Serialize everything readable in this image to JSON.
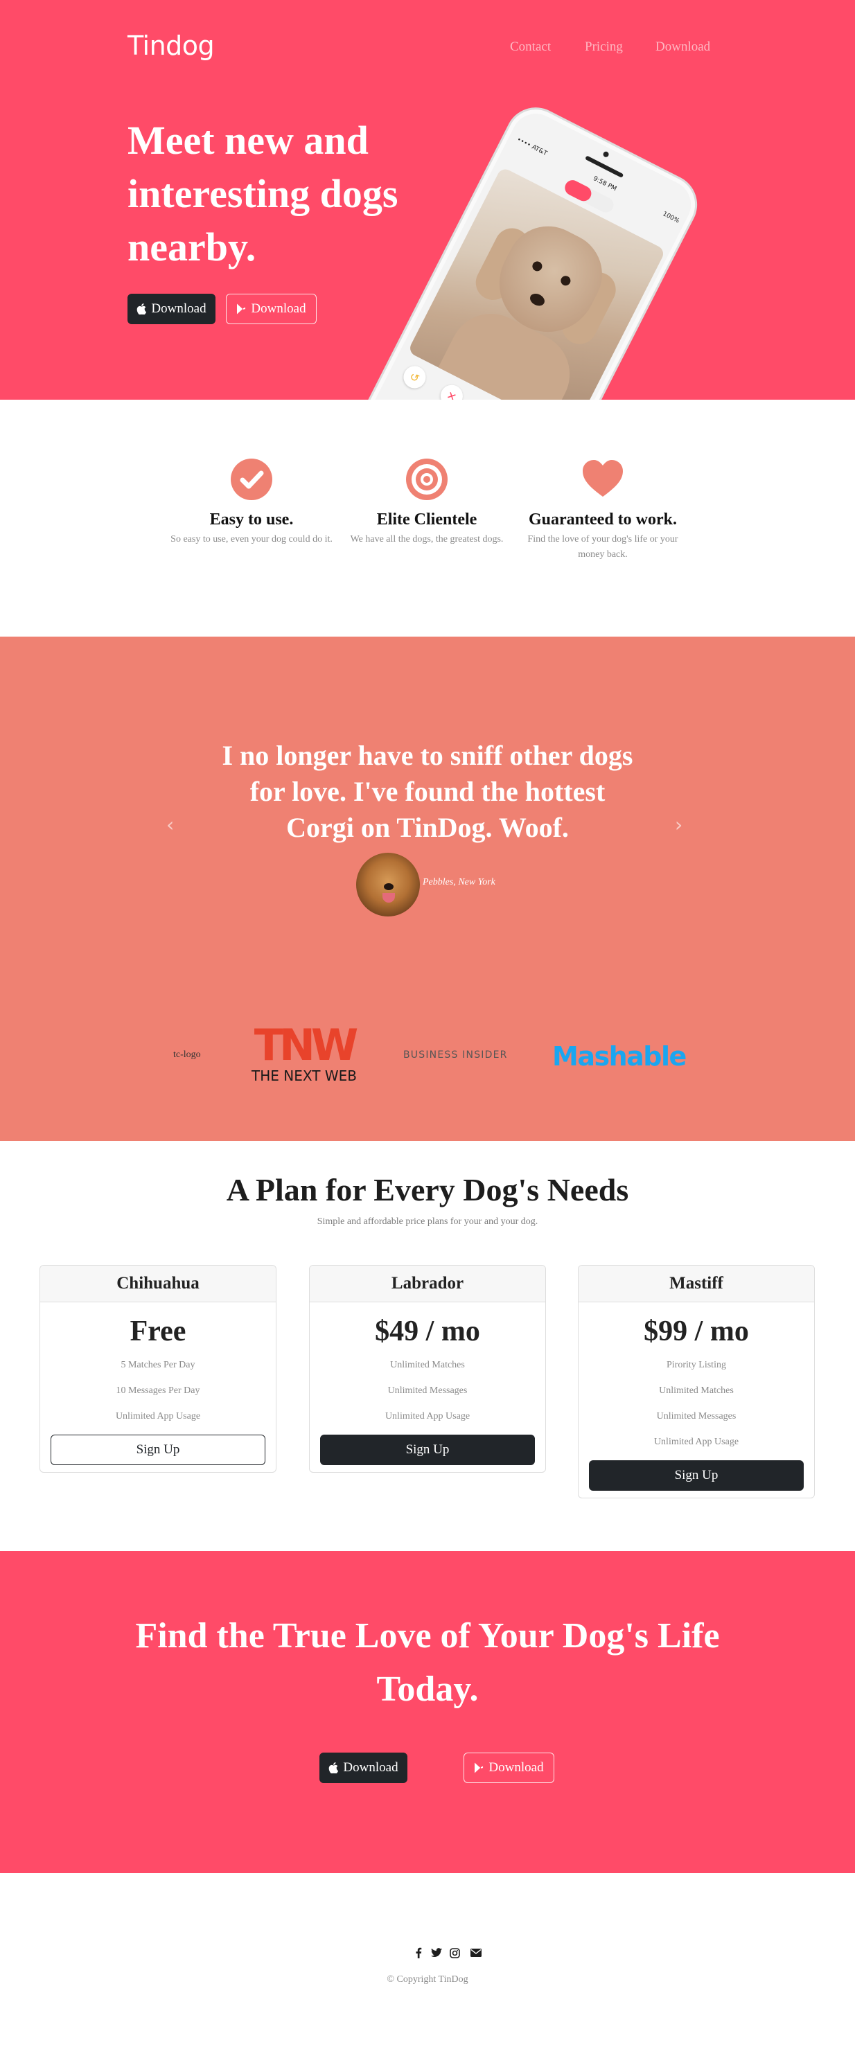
{
  "brand": "Tindog",
  "nav": [
    {
      "label": "Contact"
    },
    {
      "label": "Pricing"
    },
    {
      "label": "Download"
    }
  ],
  "hero": {
    "title": "Meet new and interesting dogs nearby.",
    "apple_button": "Download",
    "google_button": "Download",
    "phone": {
      "carrier": "•••• AT&T",
      "time": "9:58 PM",
      "battery": "100%"
    }
  },
  "features": [
    {
      "icon": "check-circle-icon",
      "title": "Easy to use.",
      "text": "So easy to use, even your dog could do it."
    },
    {
      "icon": "bullseye-icon",
      "title": "Elite Clientele",
      "text": "We have all the dogs, the greatest dogs."
    },
    {
      "icon": "heart-icon",
      "title": "Guaranteed to work.",
      "text": "Find the love of your dog's life or your money back."
    }
  ],
  "testimonial": {
    "quote": "I no longer have to sniff other dogs for love. I've found the hottest Corgi on TinDog. Woof.",
    "author": "Pebbles, New York",
    "prev": "‹",
    "next": "›"
  },
  "press": {
    "tc_alt": "tc-logo",
    "tnw_text": "THE NEXT WEB",
    "tnw_logo": "TNW",
    "bi_text": "BUSINESS INSIDER",
    "mashable_text": "Mashable"
  },
  "pricing": {
    "title": "A Plan for Every Dog's Needs",
    "subtitle": "Simple and affordable price plans for your and your dog.",
    "plans": [
      {
        "name": "Chihuahua",
        "price": "Free",
        "features": [
          "5 Matches Per Day",
          "10 Messages Per Day",
          "Unlimited App Usage"
        ],
        "button": "Sign Up",
        "style": "outline"
      },
      {
        "name": "Labrador",
        "price": "$49 / mo",
        "features": [
          "Unlimited Matches",
          "Unlimited Messages",
          "Unlimited App Usage"
        ],
        "button": "Sign Up",
        "style": "dark"
      },
      {
        "name": "Mastiff",
        "price": "$99 / mo",
        "features": [
          "Pirority Listing",
          "Unlimited Matches",
          "Unlimited Messages",
          "Unlimited App Usage"
        ],
        "button": "Sign Up",
        "style": "dark"
      }
    ]
  },
  "cta": {
    "title": "Find the True Love of Your Dog's Life Today.",
    "apple_button": "Download",
    "google_button": "Download"
  },
  "footer": {
    "social": [
      "facebook-icon",
      "twitter-icon",
      "instagram-icon",
      "envelope-icon"
    ],
    "copyright": "© Copyright TinDog"
  },
  "colors": {
    "brand_red": "#ff4b68",
    "coral": "#ef8172",
    "dark": "#212529",
    "mashable_blue": "#1aa6f0",
    "tnw_red": "#e8432b"
  }
}
